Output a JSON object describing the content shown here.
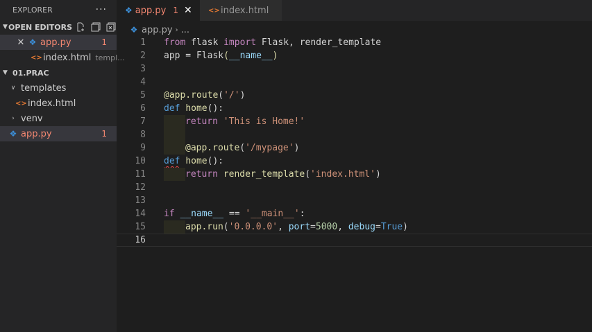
{
  "sidebar": {
    "header": "EXPLORER",
    "more_label": "···",
    "open_editors": {
      "title": "OPEN EDITORS",
      "items": [
        {
          "name": "app.py",
          "badge": "1"
        },
        {
          "name": "index.html",
          "path": "templ..."
        }
      ]
    },
    "project": {
      "title": "01.PRAC",
      "tree": [
        {
          "name": "templates"
        },
        {
          "name": "index.html"
        },
        {
          "name": "venv"
        },
        {
          "name": "app.py",
          "badge": "1"
        }
      ]
    }
  },
  "tabs": [
    {
      "label": "app.py",
      "badge": "1"
    },
    {
      "label": "index.html"
    }
  ],
  "breadcrumb": {
    "file": "app.py",
    "rest": "..."
  },
  "editor": {
    "lines": [
      {
        "num": "1",
        "tokens": [
          {
            "t": "from",
            "c": "k"
          },
          {
            "t": " flask ",
            "c": "t"
          },
          {
            "t": "import",
            "c": "k"
          },
          {
            "t": " Flask, render_template",
            "c": "t"
          }
        ]
      },
      {
        "num": "2",
        "tokens": [
          {
            "t": "app",
            "c": "t"
          },
          {
            "t": " = ",
            "c": "t"
          },
          {
            "t": "Flask",
            "c": "t"
          },
          {
            "t": "(",
            "c": "f"
          },
          {
            "t": "__name__",
            "c": "v"
          },
          {
            "t": ")",
            "c": "f"
          }
        ]
      },
      {
        "num": "3",
        "tokens": []
      },
      {
        "num": "4",
        "tokens": []
      },
      {
        "num": "5",
        "tokens": [
          {
            "t": "@app.route",
            "c": "f"
          },
          {
            "t": "(",
            "c": "t"
          },
          {
            "t": "'/'",
            "c": "s"
          },
          {
            "t": ")",
            "c": "t"
          }
        ]
      },
      {
        "num": "6",
        "tokens": [
          {
            "t": "def",
            "c": "b"
          },
          {
            "t": " ",
            "c": "t"
          },
          {
            "t": "home",
            "c": "f"
          },
          {
            "t": "():",
            "c": "t"
          }
        ]
      },
      {
        "num": "7",
        "indent": 1,
        "tokens": [
          {
            "t": "return",
            "c": "k"
          },
          {
            "t": " ",
            "c": "t"
          },
          {
            "t": "'This is Home!'",
            "c": "s"
          }
        ]
      },
      {
        "num": "8",
        "indent": 1,
        "tokens": []
      },
      {
        "num": "9",
        "indent": 1,
        "tokens": [
          {
            "t": "@app.route",
            "c": "f"
          },
          {
            "t": "(",
            "c": "t"
          },
          {
            "t": "'/mypage'",
            "c": "s"
          },
          {
            "t": ")",
            "c": "t"
          }
        ]
      },
      {
        "num": "10",
        "tokens": [
          {
            "t": "def",
            "c": "b",
            "sq": true
          },
          {
            "t": " ",
            "c": "t"
          },
          {
            "t": "home",
            "c": "f"
          },
          {
            "t": "():",
            "c": "t"
          }
        ]
      },
      {
        "num": "11",
        "indent": 1,
        "tokens": [
          {
            "t": "return",
            "c": "k"
          },
          {
            "t": " ",
            "c": "t"
          },
          {
            "t": "render_template",
            "c": "f"
          },
          {
            "t": "(",
            "c": "t"
          },
          {
            "t": "'index.html'",
            "c": "s"
          },
          {
            "t": ")",
            "c": "t"
          }
        ]
      },
      {
        "num": "12",
        "tokens": []
      },
      {
        "num": "13",
        "tokens": []
      },
      {
        "num": "14",
        "tokens": [
          {
            "t": "if",
            "c": "k"
          },
          {
            "t": " ",
            "c": "t"
          },
          {
            "t": "__name__",
            "c": "v"
          },
          {
            "t": " == ",
            "c": "t"
          },
          {
            "t": "'__main__'",
            "c": "s"
          },
          {
            "t": ":",
            "c": "t"
          }
        ]
      },
      {
        "num": "15",
        "indent": 1,
        "tokens": [
          {
            "t": "app.run",
            "c": "f"
          },
          {
            "t": "(",
            "c": "t"
          },
          {
            "t": "'0.0.0.0'",
            "c": "s"
          },
          {
            "t": ", ",
            "c": "t"
          },
          {
            "t": "port",
            "c": "v"
          },
          {
            "t": "=",
            "c": "t"
          },
          {
            "t": "5000",
            "c": "n"
          },
          {
            "t": ", ",
            "c": "t"
          },
          {
            "t": "debug",
            "c": "v"
          },
          {
            "t": "=",
            "c": "t"
          },
          {
            "t": "True",
            "c": "b"
          },
          {
            "t": ")",
            "c": "t"
          }
        ]
      },
      {
        "num": "16",
        "current": true,
        "tokens": []
      }
    ]
  },
  "colors": {
    "error": "#f48771",
    "keyword": "#c586c0",
    "string": "#ce9178",
    "function": "#dcdcaa",
    "storage": "#569cd6"
  }
}
